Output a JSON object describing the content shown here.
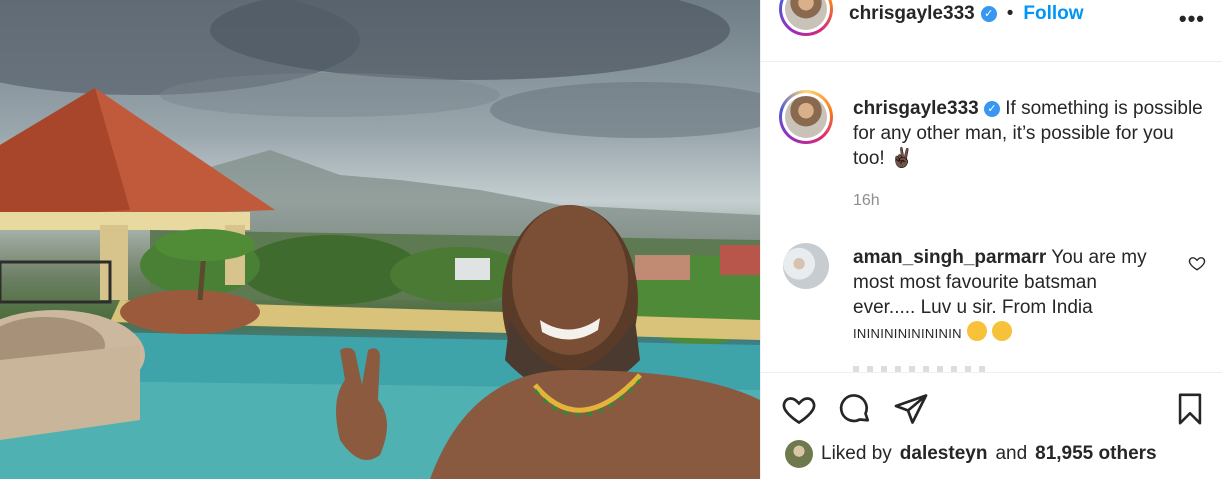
{
  "post": {
    "username": "chrisgayle333",
    "follow_label": "Follow",
    "more_label": "•••",
    "dot": "•",
    "caption_user": "chrisgayle333",
    "caption_text": "If something is possible for any other man, it’s possible for you too! ✌🏿",
    "time": "16h"
  },
  "comments": [
    {
      "username": "aman_singh_parmarr",
      "text": "You are my most most favourite batsman ever..... Luv u sir. From India",
      "flags": "ININININININININ"
    }
  ],
  "likes": {
    "prefix": "Liked by",
    "user": "dalesteyn",
    "middle": "and",
    "count": "81,955 others"
  },
  "icons": {
    "verified": "verified-badge-icon",
    "like": "heart-icon",
    "comment": "comment-bubble-icon",
    "share": "paper-plane-icon",
    "save": "bookmark-icon"
  },
  "colors": {
    "link": "#0095f6",
    "verified": "#3897f0",
    "muted": "#8e8e8e"
  }
}
